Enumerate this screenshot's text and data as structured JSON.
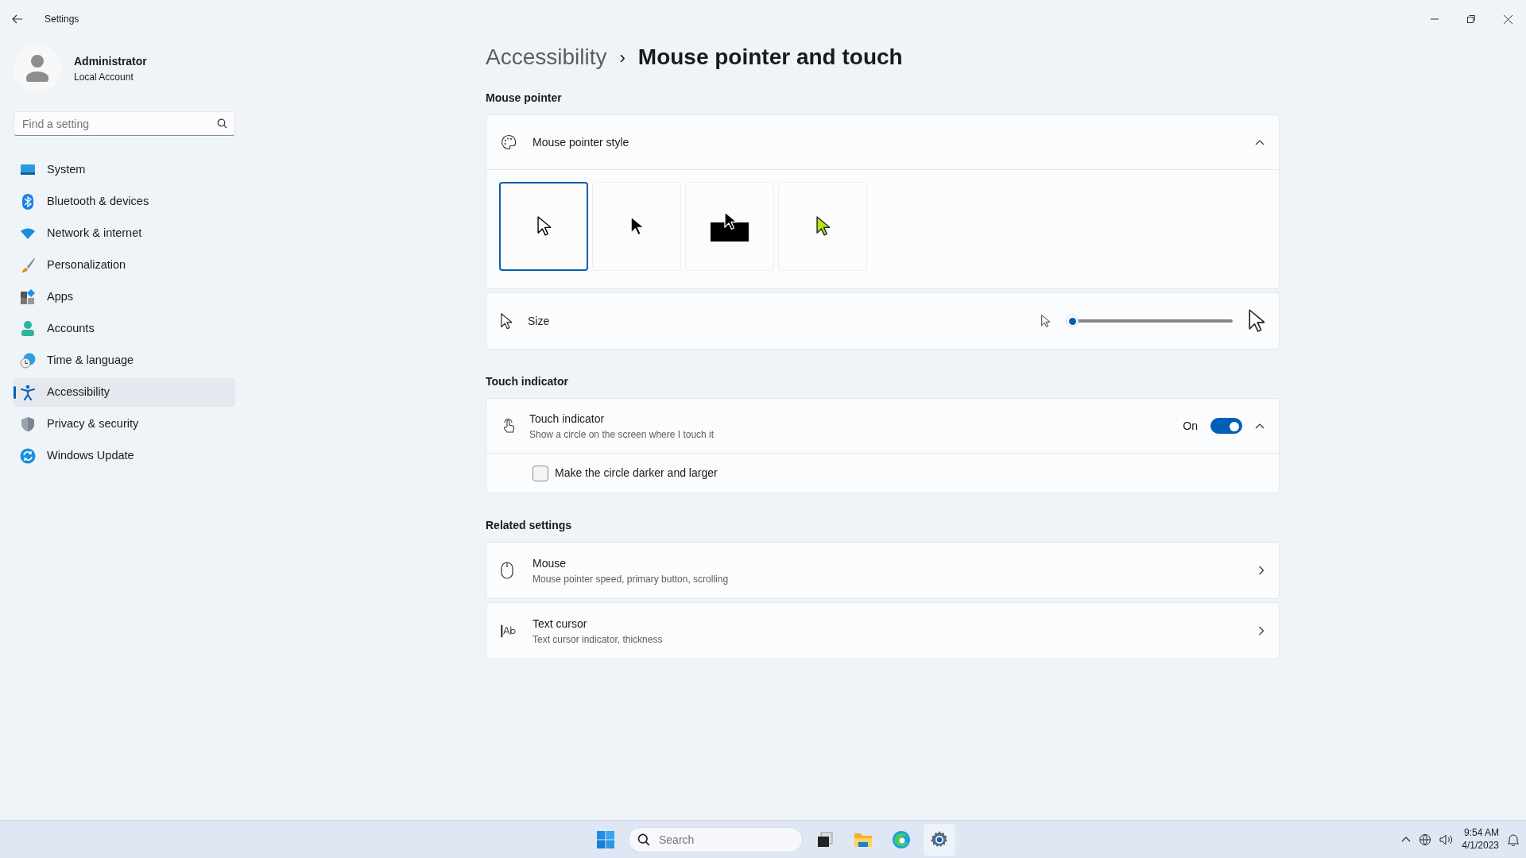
{
  "window": {
    "title": "Settings"
  },
  "user": {
    "name": "Administrator",
    "account": "Local Account"
  },
  "search": {
    "placeholder": "Find a setting"
  },
  "sidebar": {
    "items": [
      {
        "label": "System",
        "selected": false
      },
      {
        "label": "Bluetooth & devices",
        "selected": false
      },
      {
        "label": "Network & internet",
        "selected": false
      },
      {
        "label": "Personalization",
        "selected": false
      },
      {
        "label": "Apps",
        "selected": false
      },
      {
        "label": "Accounts",
        "selected": false
      },
      {
        "label": "Time & language",
        "selected": false
      },
      {
        "label": "Accessibility",
        "selected": true
      },
      {
        "label": "Privacy & security",
        "selected": false
      },
      {
        "label": "Windows Update",
        "selected": false
      }
    ]
  },
  "breadcrumb": {
    "parent": "Accessibility",
    "separator": "›",
    "current": "Mouse pointer and touch"
  },
  "mouse_pointer": {
    "heading": "Mouse pointer",
    "style": {
      "label": "Mouse pointer style",
      "expanded": true,
      "options": [
        {
          "kind": "white",
          "selected": true
        },
        {
          "kind": "black",
          "selected": false
        },
        {
          "kind": "inverted",
          "selected": false
        },
        {
          "kind": "custom",
          "selected": false
        }
      ]
    },
    "size": {
      "label": "Size",
      "level": 0
    }
  },
  "touch": {
    "heading": "Touch indicator",
    "title": "Touch indicator",
    "description": "Show a circle on the screen where I touch it",
    "state_label": "On",
    "on": true,
    "expanded": true,
    "option": {
      "label": "Make the circle darker and larger",
      "checked": false
    }
  },
  "related": {
    "heading": "Related settings",
    "items": [
      {
        "title": "Mouse",
        "description": "Mouse pointer speed, primary button, scrolling"
      },
      {
        "title": "Text cursor",
        "description": "Text cursor indicator, thickness"
      }
    ]
  },
  "taskbar": {
    "search_placeholder": "Search",
    "time": "9:54 AM",
    "date": "4/1/2023"
  }
}
